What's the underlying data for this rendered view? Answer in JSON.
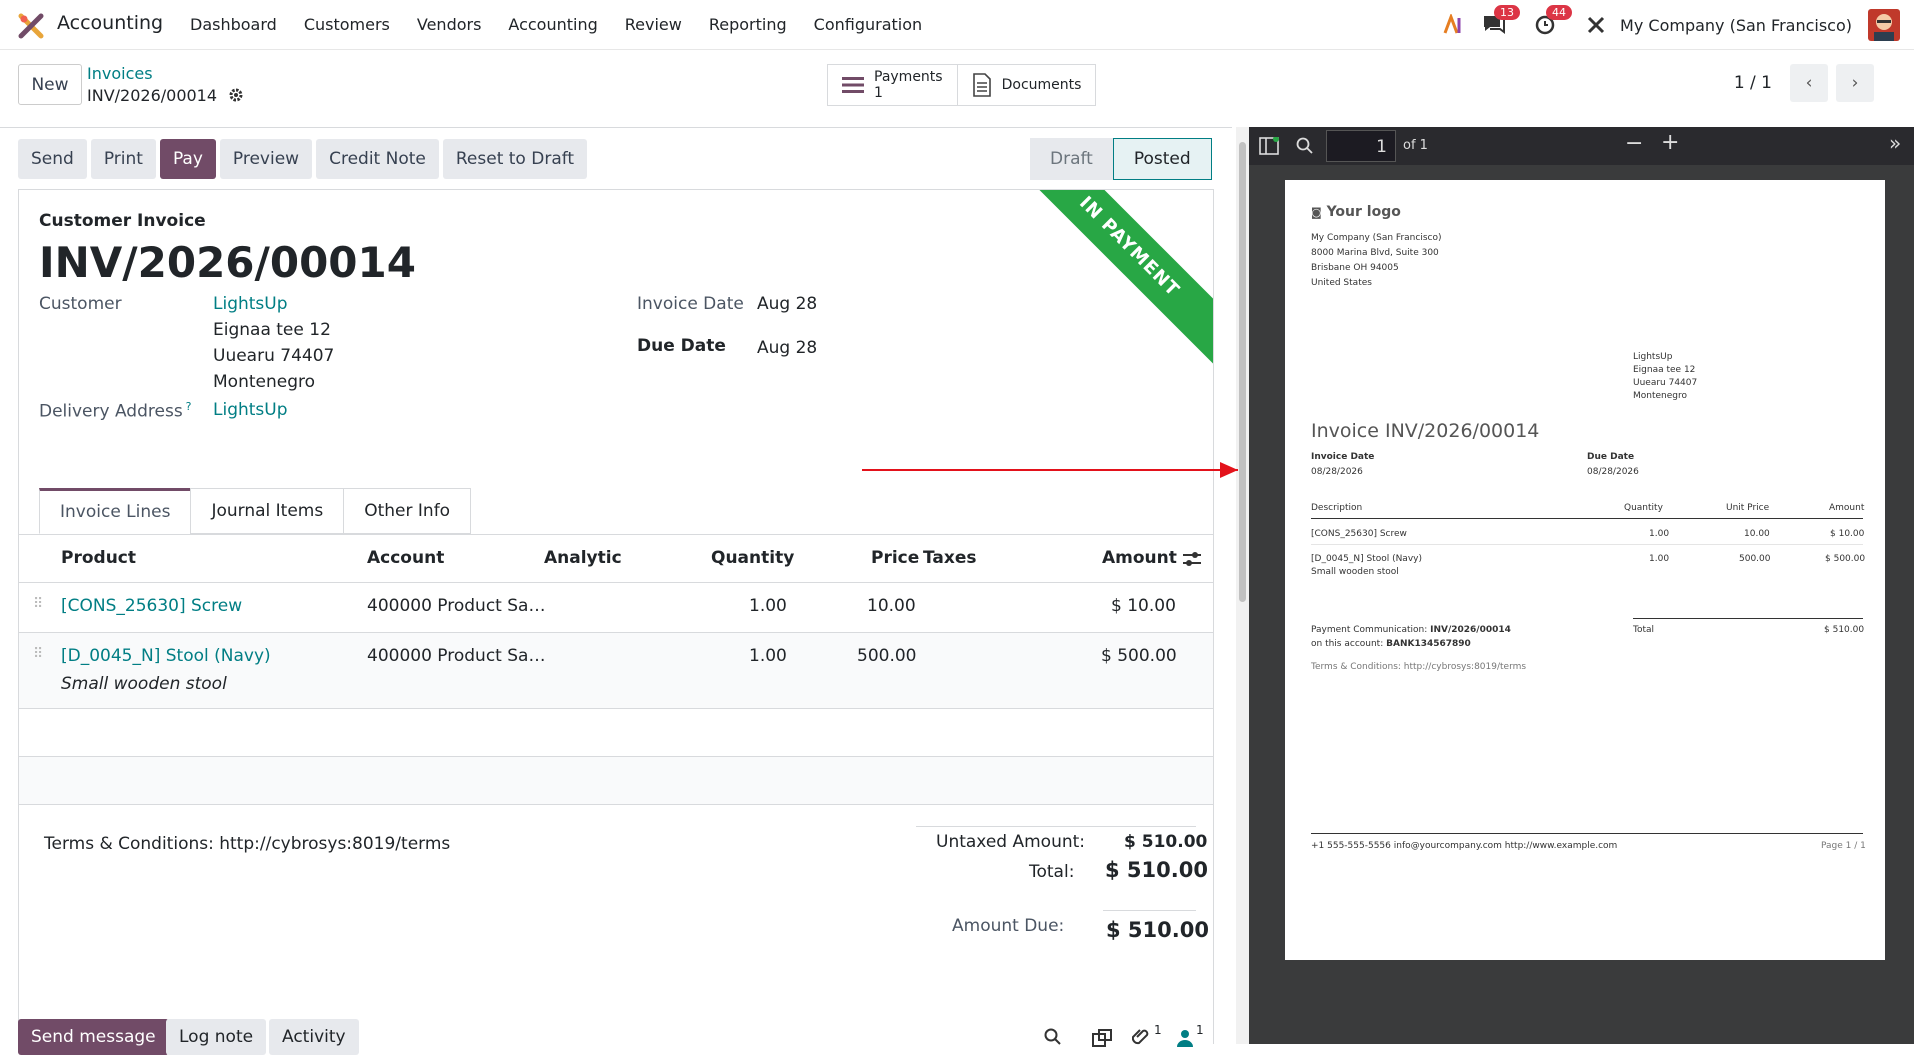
{
  "app": {
    "name": "Accounting",
    "menu": [
      "Dashboard",
      "Customers",
      "Vendors",
      "Accounting",
      "Review",
      "Reporting",
      "Configuration"
    ],
    "company": "My Company (San Francisco)",
    "chat_count": "13",
    "activity_count": "44"
  },
  "controlpanel": {
    "new_label": "New",
    "breadcrumb_parent": "Invoices",
    "breadcrumb_current": "INV/2026/00014",
    "smart_payments_label": "Payments",
    "smart_payments_count": "1",
    "smart_documents_label": "Documents",
    "pager": "1 / 1"
  },
  "actions": [
    "Send",
    "Print",
    "Pay",
    "Preview",
    "Credit Note",
    "Reset to Draft"
  ],
  "status": {
    "draft": "Draft",
    "posted": "Posted"
  },
  "form": {
    "ribbon": "IN PAYMENT",
    "type_label": "Customer Invoice",
    "number": "INV/2026/00014",
    "customer_label": "Customer",
    "customer_name": "LightsUp",
    "customer_addr1": "Eignaa tee 12",
    "customer_addr2": "Uuearu 74407",
    "customer_addr3": "Montenegro",
    "delivery_label": "Delivery Address",
    "delivery_help": "?",
    "delivery_value": "LightsUp",
    "invoice_date_label": "Invoice Date",
    "invoice_date": "Aug 28",
    "due_date_label": "Due Date",
    "due_date": "Aug 28"
  },
  "tabs": [
    "Invoice Lines",
    "Journal Items",
    "Other Info"
  ],
  "table": {
    "headers": {
      "product": "Product",
      "account": "Account",
      "analytic": "Analytic",
      "quantity": "Quantity",
      "price": "Price",
      "taxes": "Taxes",
      "amount": "Amount"
    },
    "rows": [
      {
        "product": "[CONS_25630] Screw",
        "desc": "",
        "account": "400000 Product Sa…",
        "quantity": "1.00",
        "price": "10.00",
        "amount": "$ 10.00"
      },
      {
        "product": "[D_0045_N] Stool (Navy)",
        "desc": "Small wooden stool",
        "account": "400000 Product Sa…",
        "quantity": "1.00",
        "price": "500.00",
        "amount": "$ 500.00"
      }
    ]
  },
  "totals": {
    "terms": "Terms & Conditions: http://cybrosys:8019/terms",
    "untaxed_label": "Untaxed Amount:",
    "untaxed": "$ 510.00",
    "total_label": "Total:",
    "total": "$ 510.00",
    "due_label": "Amount Due:",
    "due": "$ 510.00"
  },
  "chatter": {
    "send": "Send message",
    "log": "Log note",
    "activity": "Activity",
    "attach_count": "1",
    "follower_count": "1"
  },
  "pdf": {
    "page_input": "1",
    "page_of": "of 1",
    "logo": "Your logo",
    "company_lines": [
      "My Company (San Francisco)",
      "8000 Marina Blvd, Suite 300",
      "Brisbane OH 94005",
      "United States"
    ],
    "cust_lines": [
      "LightsUp",
      "Eignaa tee 12",
      "Uuearu 74407",
      "Montenegro"
    ],
    "title": "Invoice INV/2026/00014",
    "inv_date_label": "Invoice Date",
    "inv_date": "08/28/2026",
    "due_date_label": "Due Date",
    "due_date": "08/28/2026",
    "th_desc": "Description",
    "th_qty": "Quantity",
    "th_price": "Unit Price",
    "th_amount": "Amount",
    "lines": [
      {
        "desc": "[CONS_25630] Screw",
        "sub": "",
        "qty": "1.00",
        "price": "10.00",
        "amount": "$ 10.00"
      },
      {
        "desc": "[D_0045_N] Stool (Navy)",
        "sub": "Small wooden stool",
        "qty": "1.00",
        "price": "500.00",
        "amount": "$ 500.00"
      }
    ],
    "total_label": "Total",
    "total": "$ 510.00",
    "pay_comm_label": "Payment Communication:",
    "pay_comm": "INV/2026/00014",
    "account_label": "on this account:",
    "account": "BANK134567890",
    "terms": "Terms & Conditions: http://cybrosys:8019/terms",
    "footer": "+1 555-555-5556 info@yourcompany.com http://www.example.com",
    "page": "Page 1 / 1"
  }
}
